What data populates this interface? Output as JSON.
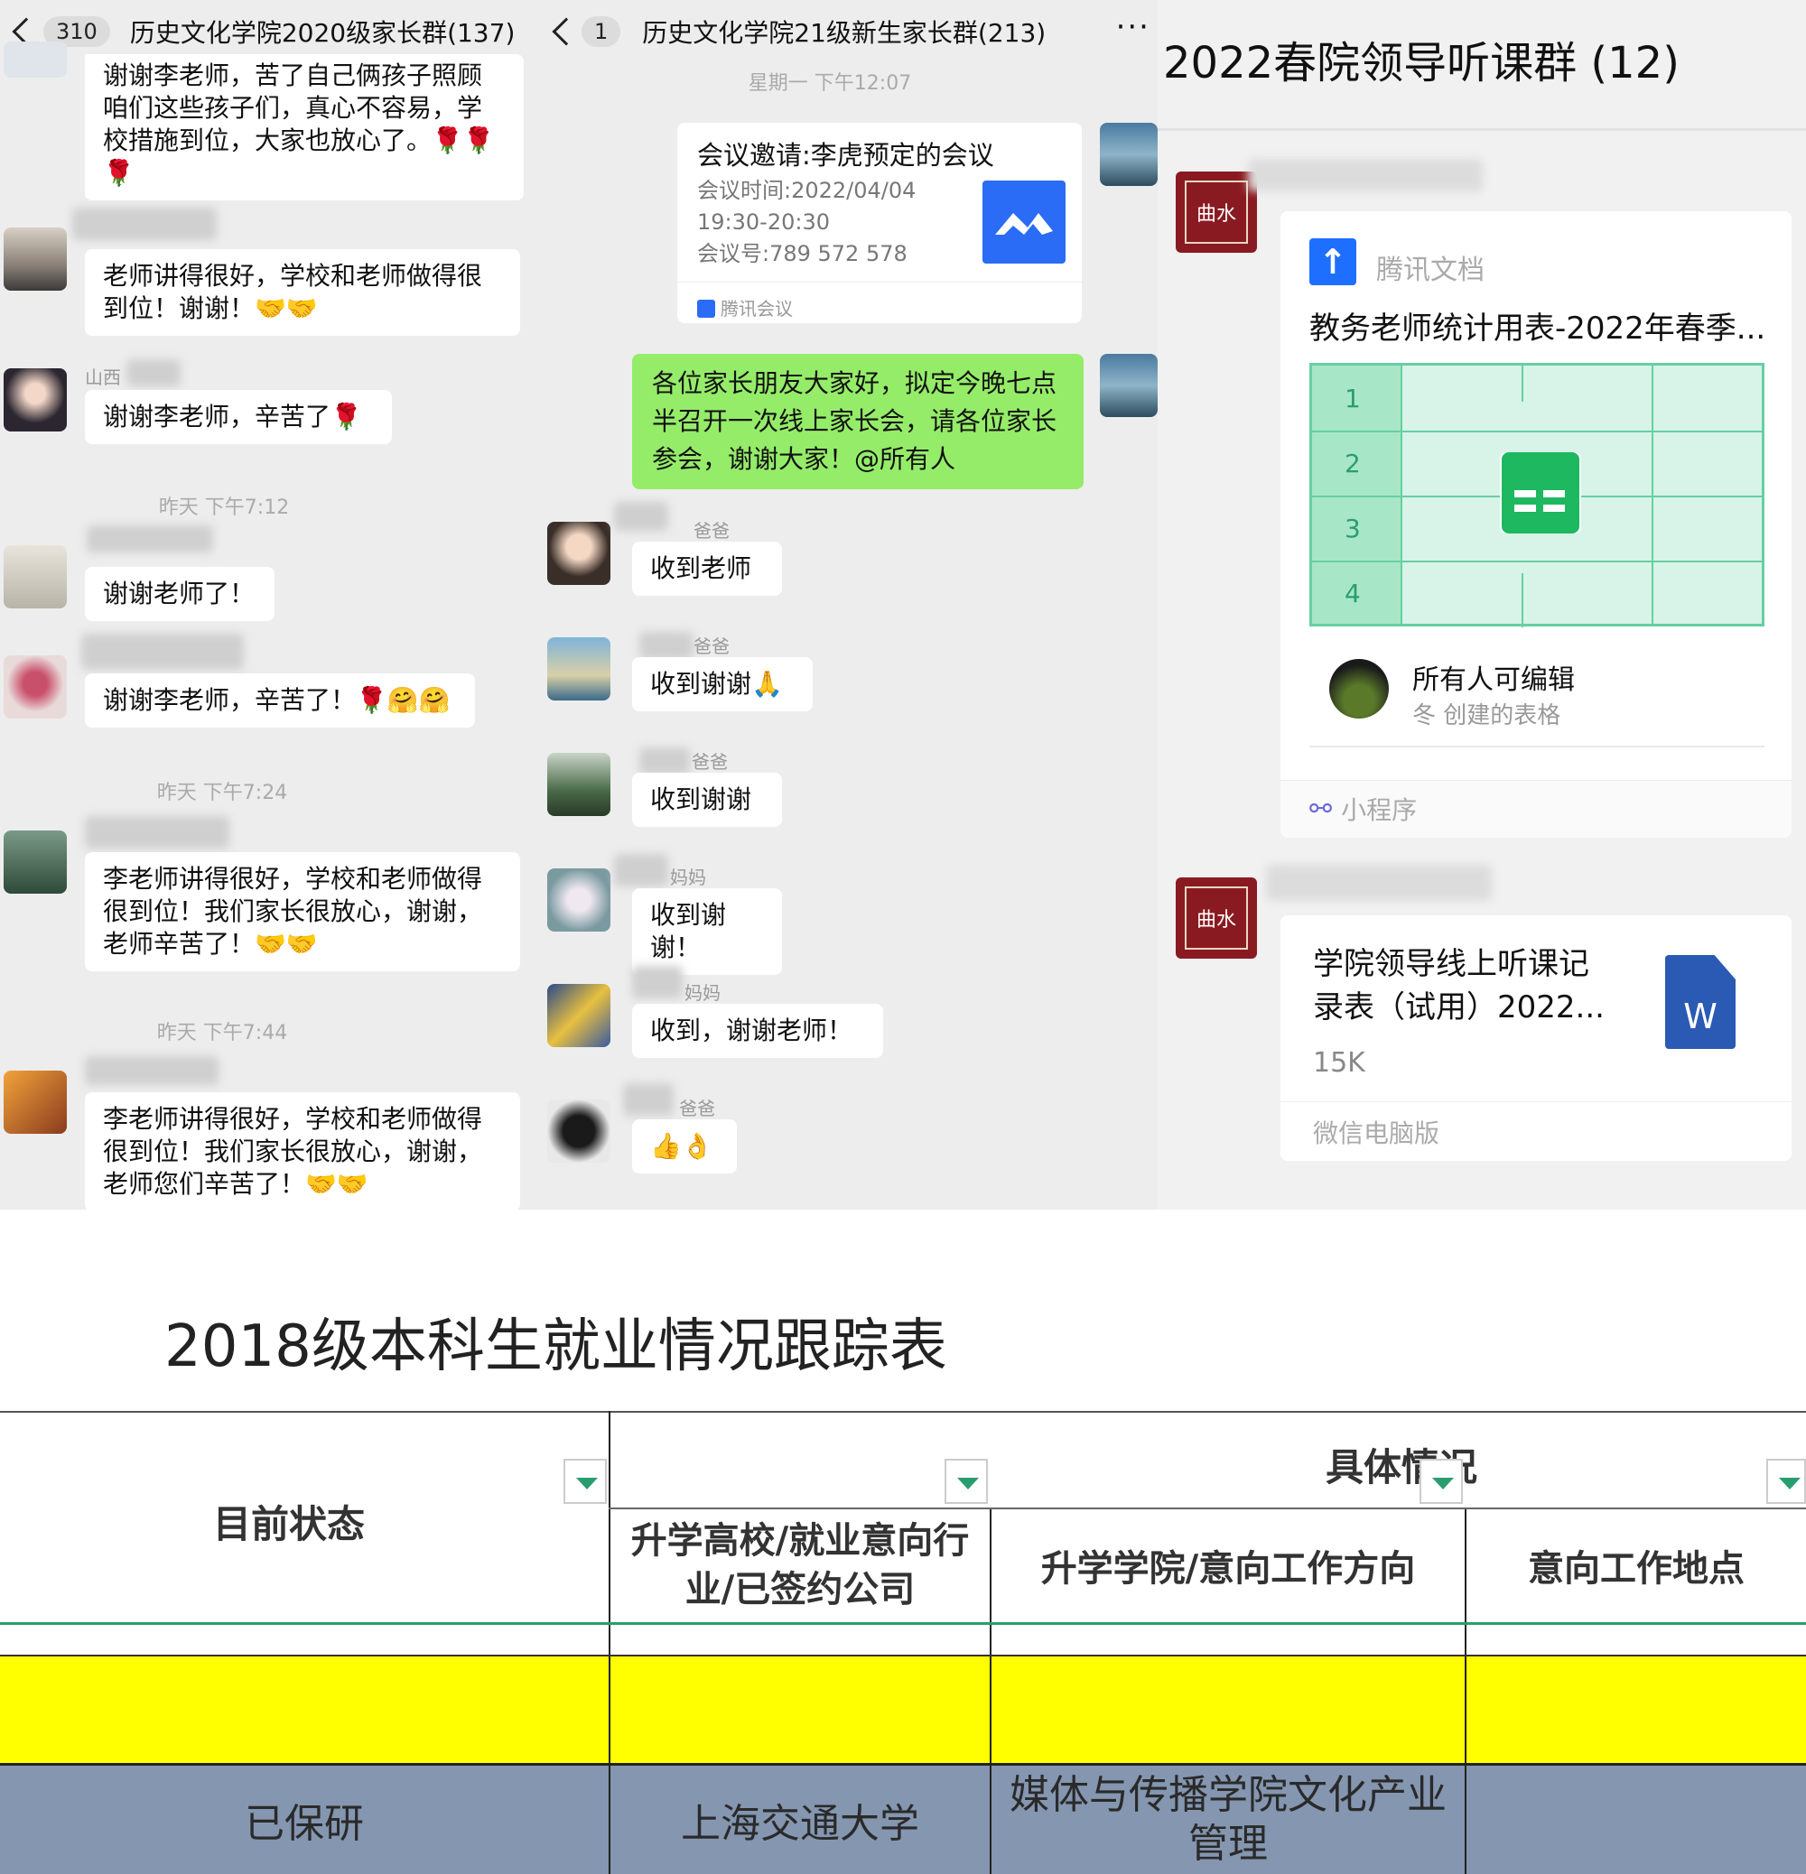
{
  "panel1": {
    "back_count": "310",
    "title": "历史文化学院2020级家长群(137)",
    "messages": [
      {
        "text": "谢谢李老师，苦了自己俩孩子照顾咱们这些孩子们，真心不容易，学校措施到位，大家也放心了。🌹🌹🌹"
      },
      {
        "text": "老师讲得很好，学校和老师做得很到位！谢谢！🤝🤝"
      },
      {
        "name": "山西",
        "text": "谢谢李老师，辛苦了🌹"
      },
      {
        "text": "谢谢老师了！"
      },
      {
        "text": "谢谢李老师，辛苦了！🌹🤗🤗"
      },
      {
        "text": "李老师讲得很好，学校和老师做得很到位！我们家长很放心，谢谢，老师辛苦了！🤝🤝"
      },
      {
        "text": "李老师讲得很好，学校和老师做得很到位！我们家长很放心，谢谢，老师您们辛苦了！🤝🤝"
      }
    ],
    "timestamps": [
      "昨天 下午7:12",
      "昨天 下午7:24",
      "昨天 下午7:44"
    ]
  },
  "panel2": {
    "back_count": "1",
    "title": "历史文化学院21级新生家长群(213)",
    "more": "···",
    "timestamp": "星期一 下午12:07",
    "meeting": {
      "title": "会议邀请:李虎预定的会议",
      "time_label": "会议时间:2022/04/04",
      "time_range": "19:30-20:30",
      "number": "会议号:789 572 578",
      "source": "腾讯会议"
    },
    "notice": "各位家长朋友大家好，拟定今晚七点半召开一次线上家长会，请各位家长参会，谢谢大家！@所有人",
    "replies": [
      {
        "name": "爸爸",
        "text": "收到老师"
      },
      {
        "name": "爸爸",
        "text": "收到谢谢🙏"
      },
      {
        "name": "爸爸",
        "text": "收到谢谢"
      },
      {
        "name": "妈妈",
        "text": "收到谢谢！"
      },
      {
        "name": "妈妈",
        "text": "收到，谢谢老师！"
      },
      {
        "name": "爸爸",
        "text": "👍👌"
      }
    ]
  },
  "panel3": {
    "title": "2022春院领导听课群 (12)",
    "doc_card": {
      "app": "腾讯文档",
      "title": "教务老师统计用表-2022年春季...",
      "rows": [
        "1",
        "2",
        "3",
        "4"
      ],
      "permission": "所有人可编辑",
      "creator": "冬 创建的表格",
      "footer": "小程序"
    },
    "file_card": {
      "title_line1": "学院领导线上听课记",
      "title_line2": "录表（试用）2022...",
      "size": "15K",
      "icon_letter": "W",
      "footer": "微信电脑版"
    }
  },
  "sheet": {
    "title": "2018级本科生就业情况跟踪表",
    "header_status": "目前状态",
    "header_group": "具体情况",
    "col1": "升学高校/就业意向行业/已签约公司",
    "col2": "升学学院/意向工作方向",
    "col3": "意向工作地点",
    "row": {
      "status": "已保研",
      "school": "上海交通大学",
      "college": "媒体与传播学院文化产业管理"
    },
    "colors": {
      "highlight": "#ffff00",
      "row_bg": "#8496b0",
      "rule": "#2a9d6f"
    }
  }
}
